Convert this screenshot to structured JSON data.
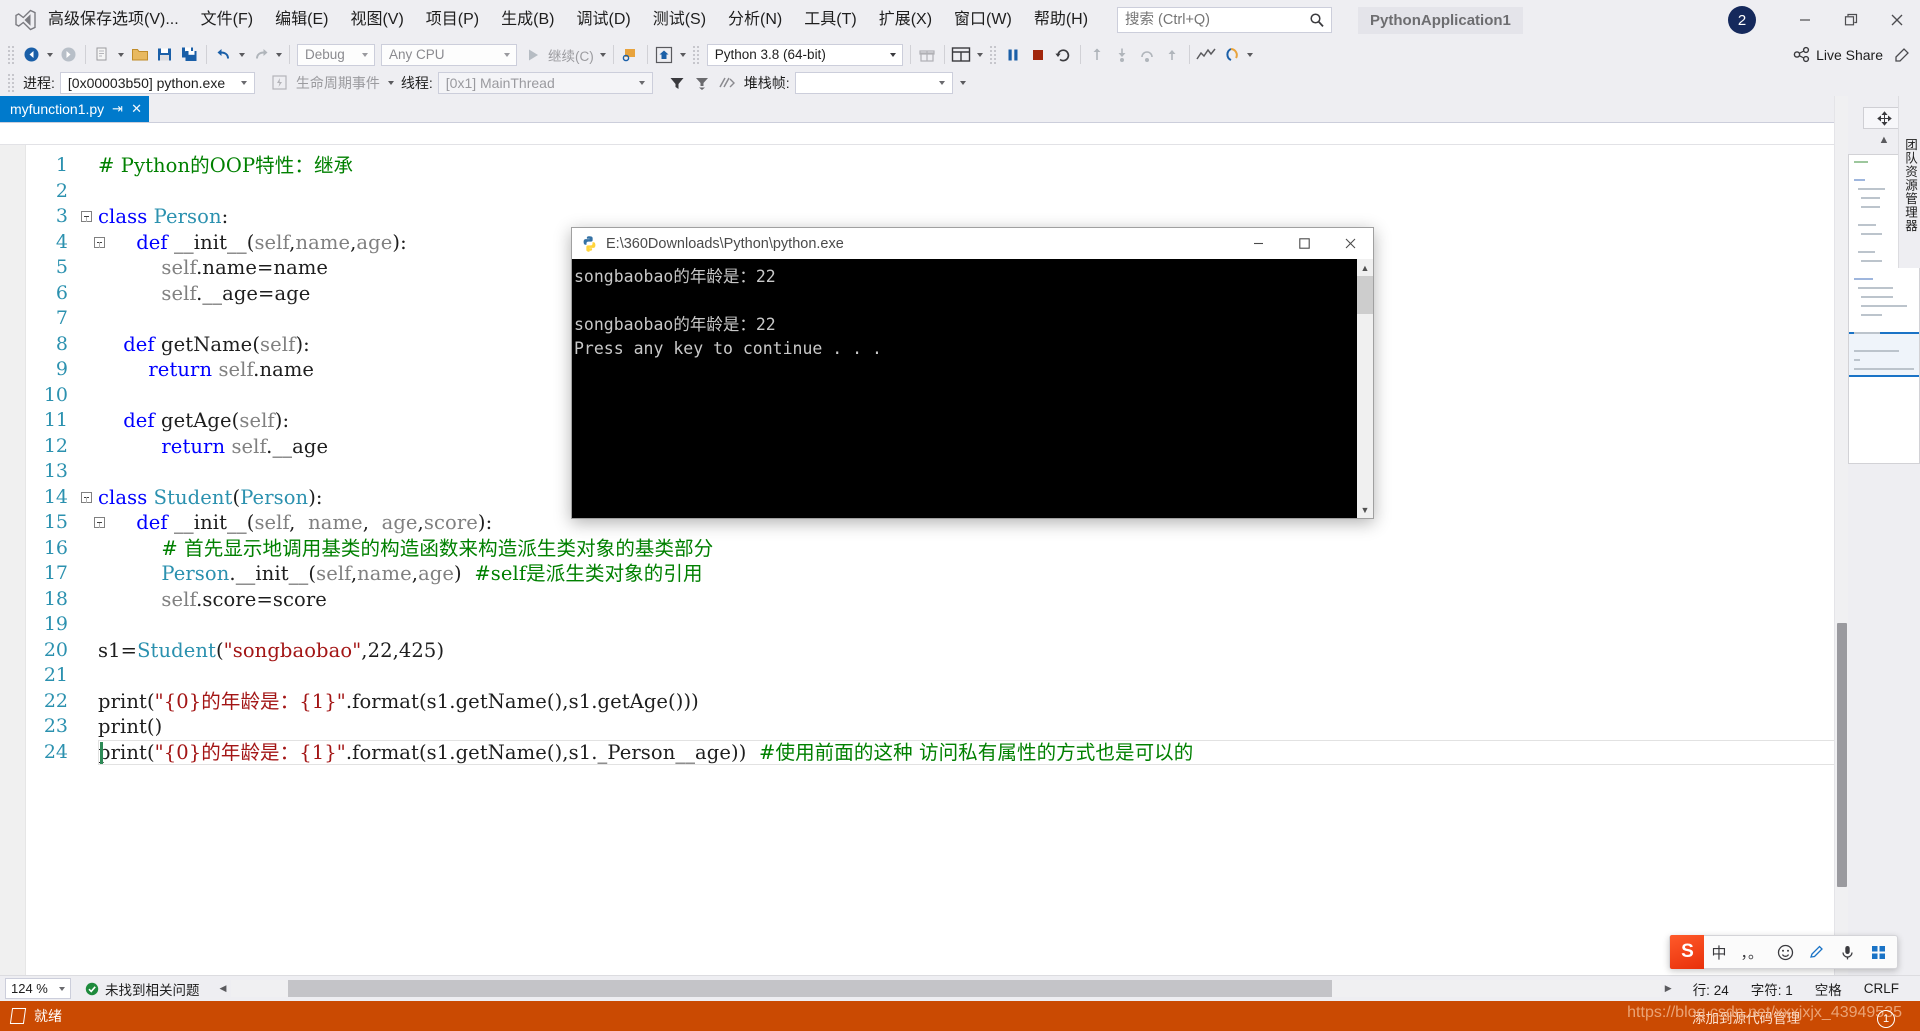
{
  "window": {
    "app_logo": "visual-studio-logo",
    "project_name": "PythonApplication1",
    "notification_count": "2",
    "minimize": "–",
    "maximize": "❐",
    "close": "✕"
  },
  "menu": {
    "items": [
      {
        "label": "高级保存选项(V)..."
      },
      {
        "label": "文件(F)"
      },
      {
        "label": "编辑(E)"
      },
      {
        "label": "视图(V)"
      },
      {
        "label": "项目(P)"
      },
      {
        "label": "生成(B)"
      },
      {
        "label": "调试(D)"
      },
      {
        "label": "测试(S)"
      },
      {
        "label": "分析(N)"
      },
      {
        "label": "工具(T)"
      },
      {
        "label": "扩展(X)"
      },
      {
        "label": "窗口(W)"
      },
      {
        "label": "帮助(H)"
      }
    ]
  },
  "search": {
    "placeholder": "搜索 (Ctrl+Q)",
    "value": ""
  },
  "toolbar": {
    "config_value": "Debug",
    "platform_value": "Any CPU",
    "continue_label": "继续(C)",
    "interpreter_value": "Python 3.8 (64-bit)",
    "live_share_label": "Live Share"
  },
  "debugbar": {
    "process_label": "进程:",
    "process_value": "[0x00003b50] python.exe",
    "lifecycle_label": "生命周期事件",
    "thread_label": "线程:",
    "thread_value": "[0x1] MainThread",
    "stackframe_label": "堆栈帧:",
    "stackframe_value": ""
  },
  "tab": {
    "filename": "myfunction1.py",
    "pin_icon": "pin-icon",
    "close_icon": "close-icon"
  },
  "code": {
    "lines": [
      {
        "n": "1",
        "fold": "",
        "tokens": [
          {
            "t": "# Python的OOP特性：继承",
            "c": "cm"
          }
        ]
      },
      {
        "n": "2",
        "fold": "",
        "tokens": []
      },
      {
        "n": "3",
        "fold": "minus",
        "tokens": [
          {
            "t": "class ",
            "c": "k"
          },
          {
            "t": "Person",
            "c": "cls"
          },
          {
            "t": ":",
            "c": "op"
          }
        ]
      },
      {
        "n": "4",
        "fold": "minus-indent",
        "tokens": [
          {
            "t": "    ",
            "c": "pl"
          },
          {
            "t": "def ",
            "c": "k"
          },
          {
            "t": "__init__",
            "c": "pl"
          },
          {
            "t": "(",
            "c": "op"
          },
          {
            "t": "self",
            "c": "id"
          },
          {
            "t": ",",
            "c": "op"
          },
          {
            "t": "name",
            "c": "id"
          },
          {
            "t": ",",
            "c": "op"
          },
          {
            "t": "age",
            "c": "id"
          },
          {
            "t": "):",
            "c": "op"
          }
        ]
      },
      {
        "n": "5",
        "fold": "line-indent",
        "tokens": [
          {
            "t": "        ",
            "c": "pl"
          },
          {
            "t": "self",
            "c": "id"
          },
          {
            "t": ".name=name",
            "c": "pl"
          }
        ]
      },
      {
        "n": "6",
        "fold": "line-indent",
        "tokens": [
          {
            "t": "        ",
            "c": "pl"
          },
          {
            "t": "self",
            "c": "id"
          },
          {
            "t": ".__age=age",
            "c": "pl"
          }
        ]
      },
      {
        "n": "7",
        "fold": "",
        "tokens": []
      },
      {
        "n": "8",
        "fold": "",
        "tokens": [
          {
            "t": "    ",
            "c": "pl"
          },
          {
            "t": "def ",
            "c": "k"
          },
          {
            "t": "getName",
            "c": "pl"
          },
          {
            "t": "(",
            "c": "op"
          },
          {
            "t": "self",
            "c": "id"
          },
          {
            "t": "):",
            "c": "op"
          }
        ]
      },
      {
        "n": "9",
        "fold": "",
        "tokens": [
          {
            "t": "        ",
            "c": "pl"
          },
          {
            "t": "return ",
            "c": "k"
          },
          {
            "t": "self",
            "c": "id"
          },
          {
            "t": ".name",
            "c": "pl"
          }
        ]
      },
      {
        "n": "10",
        "fold": "",
        "tokens": []
      },
      {
        "n": "11",
        "fold": "",
        "tokens": [
          {
            "t": "    ",
            "c": "pl"
          },
          {
            "t": "def ",
            "c": "k"
          },
          {
            "t": "getAge",
            "c": "pl"
          },
          {
            "t": "(",
            "c": "op"
          },
          {
            "t": "self",
            "c": "id"
          },
          {
            "t": "):",
            "c": "op"
          }
        ]
      },
      {
        "n": "12",
        "fold": "line-indent",
        "tokens": [
          {
            "t": "        ",
            "c": "pl"
          },
          {
            "t": "return ",
            "c": "k"
          },
          {
            "t": "self",
            "c": "id"
          },
          {
            "t": ".__age",
            "c": "pl"
          }
        ]
      },
      {
        "n": "13",
        "fold": "",
        "tokens": []
      },
      {
        "n": "14",
        "fold": "minus",
        "tokens": [
          {
            "t": "class ",
            "c": "k"
          },
          {
            "t": "Student",
            "c": "cls"
          },
          {
            "t": "(",
            "c": "op"
          },
          {
            "t": "Person",
            "c": "cls"
          },
          {
            "t": "):",
            "c": "op"
          }
        ]
      },
      {
        "n": "15",
        "fold": "minus-indent",
        "tokens": [
          {
            "t": "    ",
            "c": "pl"
          },
          {
            "t": "def ",
            "c": "k"
          },
          {
            "t": "__init__",
            "c": "pl"
          },
          {
            "t": "(",
            "c": "op"
          },
          {
            "t": "self",
            "c": "id"
          },
          {
            "t": ",  ",
            "c": "op"
          },
          {
            "t": "name",
            "c": "id"
          },
          {
            "t": ",  ",
            "c": "op"
          },
          {
            "t": "age",
            "c": "id"
          },
          {
            "t": ",",
            "c": "op"
          },
          {
            "t": "score",
            "c": "id"
          },
          {
            "t": "):",
            "c": "op"
          }
        ]
      },
      {
        "n": "16",
        "fold": "line-indent",
        "tokens": [
          {
            "t": "        ",
            "c": "pl"
          },
          {
            "t": "# 首先显示地调用基类的构造函数来构造派生类对象的基类部分",
            "c": "cm"
          }
        ]
      },
      {
        "n": "17",
        "fold": "line-indent",
        "tokens": [
          {
            "t": "        ",
            "c": "pl"
          },
          {
            "t": "Person",
            "c": "cls"
          },
          {
            "t": ".__init__",
            "c": "pl"
          },
          {
            "t": "(",
            "c": "op"
          },
          {
            "t": "self",
            "c": "id"
          },
          {
            "t": ",",
            "c": "op"
          },
          {
            "t": "name",
            "c": "id"
          },
          {
            "t": ",",
            "c": "op"
          },
          {
            "t": "age",
            "c": "id"
          },
          {
            "t": ")  ",
            "c": "op"
          },
          {
            "t": "#self是派生类对象的引用",
            "c": "cm"
          }
        ]
      },
      {
        "n": "18",
        "fold": "line-indent",
        "tokens": [
          {
            "t": "        ",
            "c": "pl"
          },
          {
            "t": "self",
            "c": "id"
          },
          {
            "t": ".score=score",
            "c": "pl"
          }
        ]
      },
      {
        "n": "19",
        "fold": "",
        "tokens": []
      },
      {
        "n": "20",
        "fold": "",
        "tokens": [
          {
            "t": "s1=",
            "c": "pl"
          },
          {
            "t": "Student",
            "c": "cls"
          },
          {
            "t": "(",
            "c": "op"
          },
          {
            "t": "\"songbaobao\"",
            "c": "str"
          },
          {
            "t": ",",
            "c": "op"
          },
          {
            "t": "22",
            "c": "num"
          },
          {
            "t": ",",
            "c": "op"
          },
          {
            "t": "425",
            "c": "num"
          },
          {
            "t": ")",
            "c": "op"
          }
        ]
      },
      {
        "n": "21",
        "fold": "",
        "tokens": []
      },
      {
        "n": "22",
        "fold": "",
        "tokens": [
          {
            "t": "print",
            "c": "pl"
          },
          {
            "t": "(",
            "c": "op"
          },
          {
            "t": "\"{0}的年龄是：{1}\"",
            "c": "str"
          },
          {
            "t": ".format(s1.getName(),s1.getAge()))",
            "c": "pl"
          }
        ]
      },
      {
        "n": "23",
        "fold": "",
        "tokens": [
          {
            "t": "print()",
            "c": "pl"
          }
        ]
      },
      {
        "n": "24",
        "fold": "",
        "tokens": [
          {
            "t": "print",
            "c": "pl"
          },
          {
            "t": "(",
            "c": "op"
          },
          {
            "t": "\"{0}的年龄是：{1}\"",
            "c": "str"
          },
          {
            "t": ".format(s1.getName(),s1._Person__age))  ",
            "c": "pl"
          },
          {
            "t": "#使用前面的这种 访问私有属性的方式也是可以的",
            "c": "cm"
          }
        ]
      }
    ],
    "current_line_index": 23
  },
  "console": {
    "title": "E:\\360Downloads\\Python\\python.exe",
    "icon": "python-icon",
    "minimize": "–",
    "maximize": "❐",
    "close": "✕",
    "output": "songbaobao的年龄是：22\n\nsongbaobao的年龄是：22\nPress any key to continue . . ."
  },
  "right_dock": {
    "vertical_tab": "团队资源管理器",
    "float_icon": "move-icon",
    "collapse_icon": "chevron-up-icon"
  },
  "status": {
    "zoom": "124 %",
    "issues": "未找到相关问题",
    "issues_icon": "check-circle-icon",
    "line_label": "行: 24",
    "char_label": "字符: 1",
    "spaces_label": "空格",
    "eol_label": "CRLF"
  },
  "taskbar": {
    "ready_label": "就绪",
    "source_control": "添加到源代码管理",
    "watermark": "https://blog.csdn.net/xxxjxjx_43949535",
    "badge": "1"
  },
  "ime": {
    "logo": "S",
    "mode": "中",
    "punct": "，。",
    "emoji_icon": "emoji-icon",
    "pen_icon": "pen-icon",
    "mic_icon": "mic-icon",
    "apps_icon": "apps-icon"
  },
  "colors": {
    "accent": "#007acc",
    "chrome": "#eeeef2",
    "taskbar": "#ca4a02",
    "console_bg": "#000000",
    "keyword": "#0000ff",
    "type": "#2b91af",
    "string": "#a31515",
    "comment": "#008000",
    "param": "#808080"
  }
}
